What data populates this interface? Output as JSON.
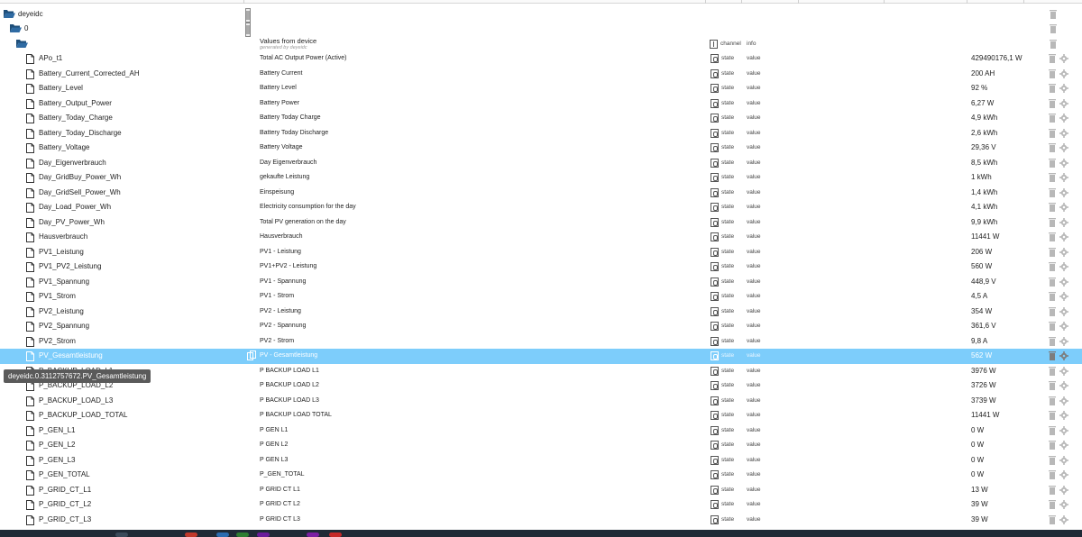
{
  "tree": {
    "root_label": "deyeidc",
    "instance_label": "0",
    "header_desc": "Values from device",
    "header_sub": "generated by deyeidc",
    "header_channel": "channel",
    "header_info": "info"
  },
  "rows": [
    {
      "name": "APo_t1",
      "desc": "Total AC Output Power (Active)",
      "type": "state",
      "role": "value",
      "val": "429490176,1 W"
    },
    {
      "name": "Battery_Current_Corrected_AH",
      "desc": "Battery Current",
      "type": "state",
      "role": "value",
      "val": "200 AH"
    },
    {
      "name": "Battery_Level",
      "desc": "Battery Level",
      "type": "state",
      "role": "value",
      "val": "92 %"
    },
    {
      "name": "Battery_Output_Power",
      "desc": "Battery Power",
      "type": "state",
      "role": "value",
      "val": "6,27 W"
    },
    {
      "name": "Battery_Today_Charge",
      "desc": "Battery Today Charge",
      "type": "state",
      "role": "value",
      "val": "4,9 kWh"
    },
    {
      "name": "Battery_Today_Discharge",
      "desc": "Battery Today Discharge",
      "type": "state",
      "role": "value",
      "val": "2,6 kWh"
    },
    {
      "name": "Battery_Voltage",
      "desc": "Battery Voltage",
      "type": "state",
      "role": "value",
      "val": "29,36 V"
    },
    {
      "name": "Day_Eigenverbrauch",
      "desc": "Day Eigenverbrauch",
      "type": "state",
      "role": "value",
      "val": "8,5 kWh"
    },
    {
      "name": "Day_GridBuy_Power_Wh",
      "desc": "gekaufte Leistung",
      "type": "state",
      "role": "value",
      "val": "1 kWh"
    },
    {
      "name": "Day_GridSell_Power_Wh",
      "desc": "Einspeisung",
      "type": "state",
      "role": "value",
      "val": "1,4 kWh"
    },
    {
      "name": "Day_Load_Power_Wh",
      "desc": "Electricity consumption for the day",
      "type": "state",
      "role": "value",
      "val": "4,1 kWh"
    },
    {
      "name": "Day_PV_Power_Wh",
      "desc": "Total PV generation on the day",
      "type": "state",
      "role": "value",
      "val": "9,9 kWh"
    },
    {
      "name": "Hausverbrauch",
      "desc": "Hausverbrauch",
      "type": "state",
      "role": "value",
      "val": "11441 W"
    },
    {
      "name": "PV1_Leistung",
      "desc": "PV1 - Leistung",
      "type": "state",
      "role": "value",
      "val": "206 W"
    },
    {
      "name": "PV1_PV2_Leistung",
      "desc": "PV1+PV2 - Leistung",
      "type": "state",
      "role": "value",
      "val": "560 W"
    },
    {
      "name": "PV1_Spannung",
      "desc": "PV1 - Spannung",
      "type": "state",
      "role": "value",
      "val": "448,9 V"
    },
    {
      "name": "PV1_Strom",
      "desc": "PV1 - Strom",
      "type": "state",
      "role": "value",
      "val": "4,5 A"
    },
    {
      "name": "PV2_Leistung",
      "desc": "PV2 - Leistung",
      "type": "state",
      "role": "value",
      "val": "354 W"
    },
    {
      "name": "PV2_Spannung",
      "desc": "PV2 - Spannung",
      "type": "state",
      "role": "value",
      "val": "361,6 V"
    },
    {
      "name": "PV2_Strom",
      "desc": "PV2 - Strom",
      "type": "state",
      "role": "value",
      "val": "9,8 A"
    },
    {
      "name": "PV_Gesamtleistung",
      "desc": "PV - Gesamtleistung",
      "type": "state",
      "role": "value",
      "val": "562 W",
      "selected": true
    },
    {
      "name": "P_BACKUP_LOAD_L1",
      "desc": "P BACKUP LOAD L1",
      "type": "state",
      "role": "value",
      "val": "3976 W"
    },
    {
      "name": "P_BACKUP_LOAD_L2",
      "desc": "P BACKUP LOAD L2",
      "type": "state",
      "role": "value",
      "val": "3726 W"
    },
    {
      "name": "P_BACKUP_LOAD_L3",
      "desc": "P BACKUP LOAD L3",
      "type": "state",
      "role": "value",
      "val": "3739 W"
    },
    {
      "name": "P_BACKUP_LOAD_TOTAL",
      "desc": "P BACKUP LOAD TOTAL",
      "type": "state",
      "role": "value",
      "val": "11441 W"
    },
    {
      "name": "P_GEN_L1",
      "desc": "P GEN L1",
      "type": "state",
      "role": "value",
      "val": "0 W"
    },
    {
      "name": "P_GEN_L2",
      "desc": "P GEN L2",
      "type": "state",
      "role": "value",
      "val": "0 W"
    },
    {
      "name": "P_GEN_L3",
      "desc": "P GEN L3",
      "type": "state",
      "role": "value",
      "val": "0 W"
    },
    {
      "name": "P_GEN_TOTAL",
      "desc": "P_GEN_TOTAL",
      "type": "state",
      "role": "value",
      "val": "0 W"
    },
    {
      "name": "P_GRID_CT_L1",
      "desc": "P GRID CT L1",
      "type": "state",
      "role": "value",
      "val": "13 W"
    },
    {
      "name": "P_GRID_CT_L2",
      "desc": "P GRID CT L2",
      "type": "state",
      "role": "value",
      "val": "39 W"
    },
    {
      "name": "P_GRID_CT_L3",
      "desc": "P GRID CT L3",
      "type": "state",
      "role": "value",
      "val": "39 W"
    }
  ],
  "tooltip": "deyeidc.0.3112757672.PV_Gesamtleistung",
  "colors": {
    "selected_row": "#7dcdfb",
    "folder": "#1e4e79",
    "icon_grey": "#b8b8b8"
  }
}
